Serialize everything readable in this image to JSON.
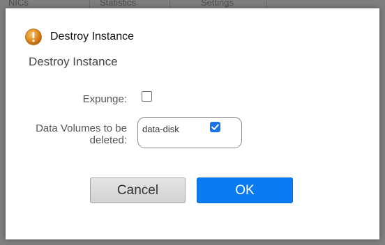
{
  "background": {
    "tabs": [
      "NICs",
      "Statistics",
      "Settings"
    ]
  },
  "dialog": {
    "title": "Destroy Instance",
    "subtitle": "Destroy Instance",
    "icon": "alert-icon",
    "accent_color": "#0a7bf0",
    "form": {
      "expunge_label": "Expunge:",
      "expunge_checked": false,
      "volumes_label_line1": "Data Volumes to be",
      "volumes_label_line2": "deleted:",
      "volumes": [
        {
          "name": "data-disk",
          "checked": true
        }
      ]
    },
    "buttons": {
      "cancel": "Cancel",
      "ok": "OK"
    }
  }
}
